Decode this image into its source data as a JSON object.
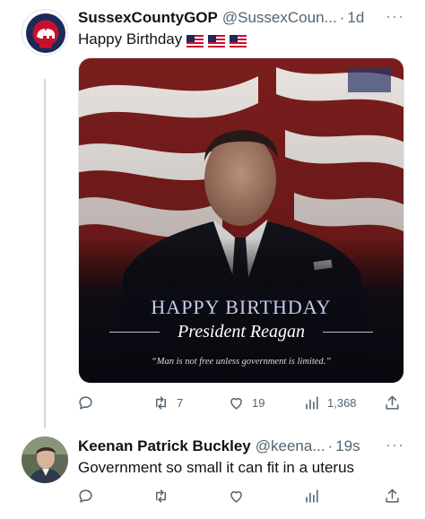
{
  "tweets": [
    {
      "display_name": "SussexCountyGOP",
      "handle": "@SussexCoun...",
      "separator": "·",
      "time": "1d",
      "more": "···",
      "avatar_text": "SUSSEX COUNTY",
      "avatar_badge": "GOP",
      "text": "Happy Birthday",
      "flags": [
        "us-flag-emoji",
        "us-flag-emoji",
        "us-flag-emoji"
      ],
      "media": {
        "title": "HAPPY BIRTHDAY",
        "subtitle": "President Reagan",
        "quote": "“Man is not free unless government is limited.”"
      },
      "actions": {
        "reply_count": "",
        "retweet_count": "7",
        "like_count": "19",
        "view_count": "1,368"
      }
    },
    {
      "display_name": "Keenan Patrick Buckley",
      "handle": "@keena...",
      "separator": "·",
      "time": "19s",
      "more": "···",
      "text": "Government so small it can fit in a uterus",
      "actions": {
        "reply_count": "",
        "retweet_count": "",
        "like_count": "",
        "view_count": ""
      }
    }
  ],
  "colors": {
    "text_primary": "#0f1419",
    "text_secondary": "#536471",
    "thread_line": "#cfd9de",
    "gop_red": "#c8102e",
    "gop_navy": "#1b2a57"
  }
}
